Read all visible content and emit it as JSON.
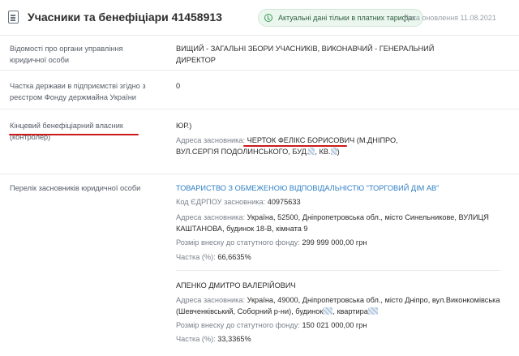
{
  "header": {
    "title": "Учасники та бенефіціари 41458913",
    "notice": "Актуальні дані тільки в платних тарифах",
    "update_date": "Дата оновлення 11.08.2021",
    "icons": {
      "document": "document-icon",
      "notice": "check-circle-icon"
    },
    "notice_color": "#eaf6ee"
  },
  "rows": {
    "governance": {
      "label": "Відомості про органи управління юридичної особи",
      "value": "ВИЩИЙ - ЗАГАЛЬНІ ЗБОРИ УЧАСНИКІВ, ВИКОНАВЧИЙ - ГЕНЕРАЛЬНИЙ ДИРЕКТОР"
    },
    "state_share": {
      "label": "Частка держави в підприємстві згідно з реєстром Фонду держмайна України",
      "value": "0"
    },
    "beneficiary": {
      "label": "Кінцевий бенефіціарний власник (контролер)",
      "value_tail": "ЮР.)",
      "address_label": "Адреса засновника:",
      "address_name": "ЧЕРТОК ФЕЛІКС БОРИСОВИЧ",
      "address_rest": "(М.ДНІПРО, ВУЛ.СЕРГІЯ ПОДОЛИНСЬКОГО, БУД.",
      "address_kv": ", КВ.",
      "address_end": ")",
      "highlight_color": "#cc1a1a"
    },
    "founders": {
      "label": "Перелік засновників юридичної особи",
      "items": [
        {
          "name": "ТОВАРИСТВО З ОБМЕЖЕНОЮ ВІДПОВІДАЛЬНІСТЮ \"ТОРГОВИЙ ДІМ АВ\"",
          "code_label": "Код ЄДРПОУ засновника:",
          "code": "40975633",
          "address_label": "Адреса засновника:",
          "address": "Україна, 52500, Дніпропетровська обл., місто Синельникове, ВУЛИЦЯ КАШТАНОВА, будинок 18-В, кімната 9",
          "capital_label": "Розмір внеску до статутного фонду:",
          "capital": "299 999 000,00 грн",
          "share_label": "Частка (%):",
          "share": "66,6635%"
        },
        {
          "name": "АПЕНКО ДМИТРО ВАЛЕРІЙОВИЧ",
          "address_label": "Адреса засновника:",
          "address": "Україна, 49000, Дніпропетровська обл., місто Дніпро, вул.Виконкомівська (Шевченківський, Соборний р-ни), будинок",
          "address_apt": ", квартира",
          "capital_label": "Розмір внеску до статутного фонду:",
          "capital": "150 021 000,00 грн",
          "share_label": "Частка (%):",
          "share": "33,3365%"
        }
      ]
    }
  }
}
